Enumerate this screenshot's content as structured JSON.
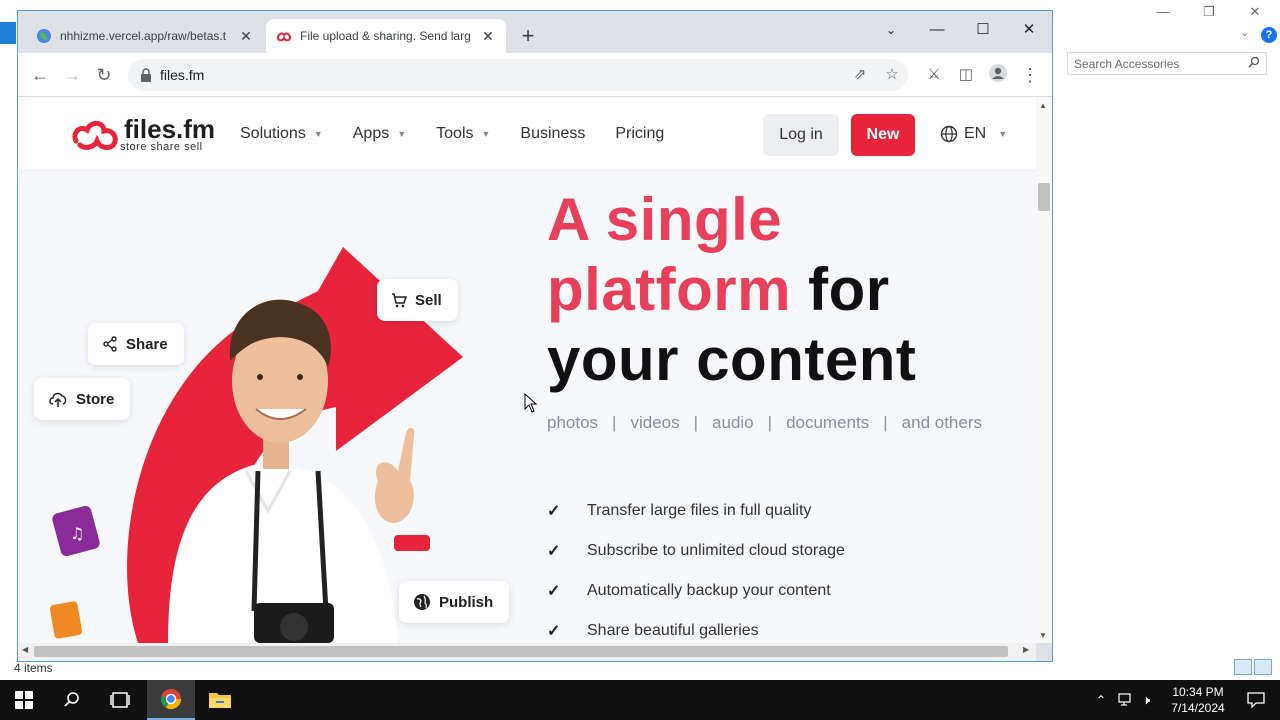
{
  "explorer": {
    "search_placeholder": "Search Accessories",
    "status_text": "4 items",
    "help_label": "?"
  },
  "browser": {
    "tabs": [
      {
        "label": "nhhizme.vercel.app/raw/betas.t",
        "active": false
      },
      {
        "label": "File upload & sharing. Send larg",
        "active": true
      }
    ],
    "new_tab_label": "+",
    "url": "files.fm"
  },
  "site": {
    "brand": "files.fm",
    "tagline": "store share sell",
    "nav": [
      {
        "label": "Solutions",
        "has_dropdown": true
      },
      {
        "label": "Apps",
        "has_dropdown": true
      },
      {
        "label": "Tools",
        "has_dropdown": true
      },
      {
        "label": "Business",
        "has_dropdown": false
      },
      {
        "label": "Pricing",
        "has_dropdown": false
      }
    ],
    "login_label": "Log in",
    "new_label": "New",
    "language": "EN",
    "accent_color": "#e8243c"
  },
  "hero": {
    "headline": {
      "line1_red": "A single",
      "line2_red": "platform",
      "line2_black": " for",
      "line3": "your content"
    },
    "categories": [
      "photos",
      "videos",
      "audio",
      "documents",
      "and others"
    ],
    "pills": {
      "sell": "Sell",
      "share": "Share",
      "store": "Store",
      "publish": "Publish"
    },
    "features": [
      "Transfer large files in full quality",
      "Subscribe to unlimited cloud storage",
      "Automatically backup your content",
      "Share beautiful galleries"
    ]
  },
  "taskbar": {
    "time": "10:34 PM",
    "date": "7/14/2024"
  }
}
